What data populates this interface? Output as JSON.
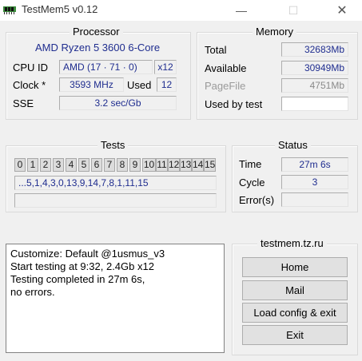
{
  "window": {
    "title": "TestMem5 v0.12",
    "minimize_glyph": "—",
    "maximize_glyph": "☐",
    "close_glyph": "✕"
  },
  "processor": {
    "group_title": "Processor",
    "name": "AMD Ryzen 5 3600 6-Core",
    "cpu_id_label": "CPU ID",
    "cpu_id_value": "AMD  (17 · 71 · 0)",
    "cpu_threads": "x12",
    "clock_label": "Clock *",
    "clock_value": "3593 MHz",
    "used_label": "Used",
    "used_value": "12",
    "sse_label": "SSE",
    "sse_value": "3.2 sec/Gb"
  },
  "memory": {
    "group_title": "Memory",
    "total_label": "Total",
    "total_value": "32683Mb",
    "available_label": "Available",
    "available_value": "30949Mb",
    "pagefile_label": "PageFile",
    "pagefile_value": "4751Mb",
    "used_by_test_label": "Used by test",
    "used_by_test_value": ""
  },
  "tests": {
    "group_title": "Tests",
    "cells": [
      "0",
      "1",
      "2",
      "3",
      "4",
      "5",
      "6",
      "7",
      "8",
      "9",
      "10",
      "11",
      "12",
      "13",
      "14",
      "15"
    ],
    "sequence": "...5,1,4,3,0,13,9,14,7,8,1,11,15",
    "progress": ""
  },
  "status": {
    "group_title": "Status",
    "time_label": "Time",
    "time_value": "27m 6s",
    "cycle_label": "Cycle",
    "cycle_value": "3",
    "errors_label": "Error(s)",
    "errors_value": ""
  },
  "log": {
    "lines": [
      "Customize: Default @1usmus_v3",
      "Start testing at 9:32, 2.4Gb x12",
      "Testing completed in 27m 6s,",
      "no errors."
    ]
  },
  "links": {
    "group_title": "testmem.tz.ru",
    "home": "Home",
    "mail": "Mail",
    "load_config": "Load config & exit",
    "exit": "Exit"
  },
  "colors": {
    "value_text": "#1f2d8f",
    "window_bg": "#f0f0f0"
  }
}
